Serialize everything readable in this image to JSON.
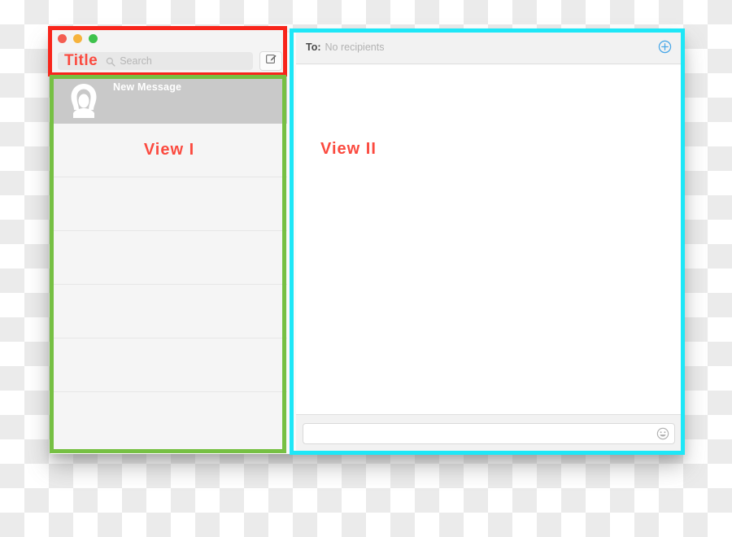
{
  "window": {
    "traffic_lights": [
      {
        "name": "close",
        "color": "#f45d51"
      },
      {
        "name": "minimize",
        "color": "#f6b33d"
      },
      {
        "name": "maximize",
        "color": "#3ec24c"
      }
    ]
  },
  "toolbar": {
    "title": "Title",
    "search_placeholder": "Search",
    "search_value": "",
    "search_icon": "search-icon",
    "compose_icon": "compose-icon"
  },
  "sidebar": {
    "selected_row": {
      "title": "New Message",
      "avatar_icon": "person-avatar-icon"
    },
    "annotation_label": "View I",
    "empty_rows": 5
  },
  "right_panel": {
    "to_label": "To:",
    "to_value": "No recipients",
    "add_recipient_icon": "plus-circle-icon",
    "annotation_label": "View II",
    "message_placeholder": "",
    "message_value": "",
    "emoji_icon": "smiley-icon"
  },
  "annotations": {
    "red_box": {
      "name": "view-title-bar-highlight",
      "color": "#f8251b"
    },
    "green_box": {
      "name": "view-one-highlight",
      "color": "#76c043"
    },
    "cyan_box": {
      "name": "view-two-highlight",
      "color": "#1ee7f7"
    }
  },
  "colors": {
    "accent_red": "#fb4a3f",
    "accent_blue": "#4aa8e8",
    "toolbar_bg": "#f4f4f4",
    "sidebar_bg": "#f5f5f5",
    "selected_row_bg": "#c9c9c9"
  }
}
